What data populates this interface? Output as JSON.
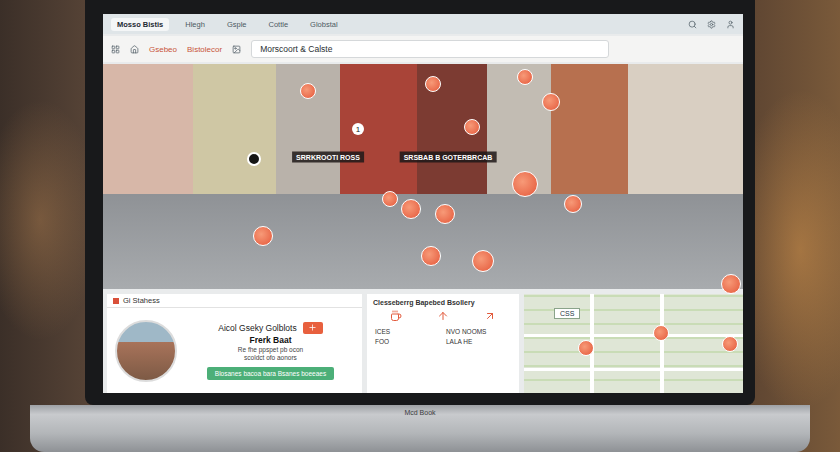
{
  "browser": {
    "tabs": [
      {
        "label": "Mosso Bistis",
        "selected": true
      },
      {
        "label": "Hlegh",
        "selected": false
      },
      {
        "label": "Gsple",
        "selected": false
      },
      {
        "label": "Cottle",
        "selected": false
      },
      {
        "label": "Globstal",
        "selected": false
      }
    ]
  },
  "toolbar": {
    "links": [
      "Gsebeo",
      "Bistolecor"
    ],
    "search": "Morscoort & Calste"
  },
  "street_view": {
    "labels": [
      "SRRKROOTI ROSS",
      "SRSBAB B GOTERBRCAB"
    ],
    "pin_badge": "1"
  },
  "place_card": {
    "header": "Gi Stahess",
    "name": "Aicol Gseky Golblots",
    "title": "Frerk Baat",
    "description": [
      "Re fhe ppspet pb ocon",
      "scoldct ofo aonors"
    ],
    "button": "Blosanes bacoa bara Bsanes boeeaes"
  },
  "details": {
    "title": "Clesseberrg Bapebed Bsollery",
    "items": [
      {
        "label": "ICES"
      },
      {
        "label": "NVO NOOMS"
      },
      {
        "label": "FOO"
      },
      {
        "label": "LALA HE"
      }
    ]
  },
  "map": {
    "label": "CSS"
  },
  "laptop": {
    "brand": "Mcd Book"
  }
}
